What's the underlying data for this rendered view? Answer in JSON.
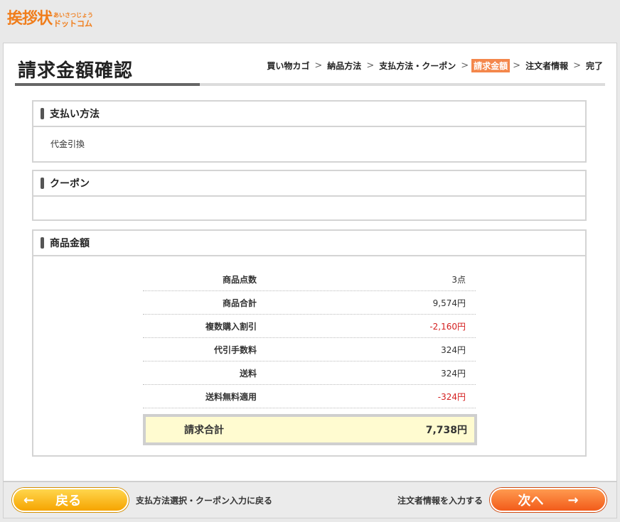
{
  "logo": {
    "main": "挨拶状",
    "sub_top": "あいさつじょう",
    "sub_bottom": "ドットコム"
  },
  "page_title": "請求金額確認",
  "steps": [
    {
      "label": "買い物カゴ",
      "active": false
    },
    {
      "label": "納品方法",
      "active": false
    },
    {
      "label": "支払方法・クーポン",
      "active": false
    },
    {
      "label": "請求金額",
      "active": true
    },
    {
      "label": "注文者情報",
      "active": false
    },
    {
      "label": "完了",
      "active": false
    }
  ],
  "step_separator": ">",
  "payment": {
    "heading": "支払い方法",
    "value": "代金引換"
  },
  "coupon": {
    "heading": "クーポン",
    "value": ""
  },
  "amount": {
    "heading": "商品金額",
    "rows": [
      {
        "label": "商品点数",
        "value": "3点"
      },
      {
        "label": "商品合計",
        "value": "9,574円"
      },
      {
        "label": "複数購入割引",
        "value": "-2,160円"
      },
      {
        "label": "代引手数料",
        "value": "324円"
      },
      {
        "label": "送料",
        "value": "324円"
      },
      {
        "label": "送料無料適用",
        "value": "-324円"
      }
    ],
    "total_label": "請求合計",
    "total_value": "7,738円"
  },
  "footer": {
    "back_label": "戻る",
    "back_link": "支払方法選択・クーポン入力に戻る",
    "next_link": "注文者情報を入力する",
    "next_label": "次へ",
    "back_arrow_icon": "arrow-left-icon",
    "next_arrow_icon": "arrow-right-icon"
  },
  "colors": {
    "brand": "#f07d1b",
    "active_step": "#f4874b",
    "negative": "#d42020",
    "total_bg": "#fffbd0"
  }
}
